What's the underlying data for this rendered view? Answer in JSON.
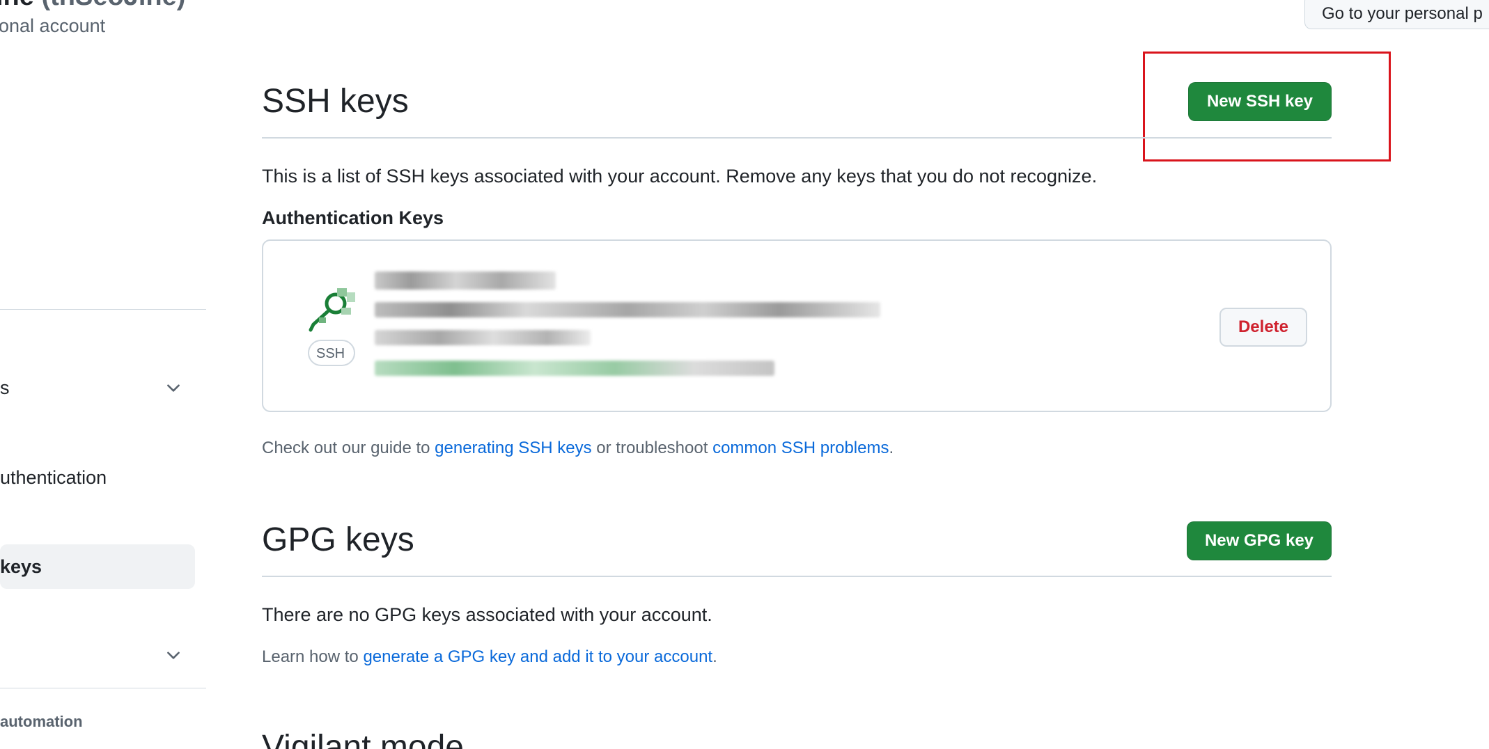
{
  "header": {
    "account_name": "ine",
    "account_handle": "(thSeoJine)",
    "account_subtitle": "onal account",
    "personal_button": "Go to your personal p"
  },
  "sidebar": {
    "item_1": "s",
    "item_2": "uthentication",
    "item_active": "keys",
    "section_heading": "automation"
  },
  "ssh": {
    "title": "SSH keys",
    "new_button": "New SSH key",
    "description": "This is a list of SSH keys associated with your account. Remove any keys that you do not recognize.",
    "auth_heading": "Authentication Keys",
    "badge": "SSH",
    "delete_button": "Delete",
    "guide_prefix": "Check out our guide to ",
    "guide_link": "generating SSH keys",
    "guide_middle": " or troubleshoot ",
    "problems_link": "common SSH problems",
    "guide_suffix": "."
  },
  "gpg": {
    "title": "GPG keys",
    "new_button": "New GPG key",
    "empty_text": "There are no GPG keys associated with your account.",
    "learn_prefix": "Learn how to ",
    "learn_link": "generate a GPG key and add it to your account",
    "learn_suffix": "."
  },
  "vigilant": {
    "title": "Vigilant mode"
  },
  "colors": {
    "primary_green": "#1f883d",
    "link_blue": "#0969da",
    "danger_red": "#cf222e",
    "highlight_red": "#d9141c",
    "border": "#d1d9e0"
  }
}
